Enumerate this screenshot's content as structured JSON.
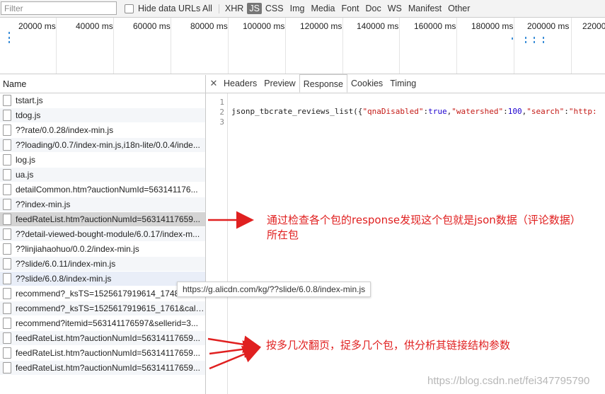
{
  "toolbar": {
    "filter_placeholder": "Filter",
    "hide_data_urls_label": "Hide data URLs",
    "type_filters": [
      "All",
      "XHR",
      "JS",
      "CSS",
      "Img",
      "Media",
      "Font",
      "Doc",
      "WS",
      "Manifest",
      "Other"
    ],
    "active_type": "JS"
  },
  "timeline": {
    "ticks": [
      "20000 ms",
      "40000 ms",
      "60000 ms",
      "80000 ms",
      "100000 ms",
      "120000 ms",
      "140000 ms",
      "160000 ms",
      "180000 ms",
      "200000 ms",
      "22000"
    ]
  },
  "request_list": {
    "header": "Name",
    "selected_index": 8,
    "hovered_index": 12,
    "rows": [
      "tstart.js",
      "tdog.js",
      "??rate/0.0.28/index-min.js",
      "??loading/0.0.7/index-min.js,i18n-lite/0.0.4/inde...",
      "log.js",
      "ua.js",
      "detailCommon.htm?auctionNumId=563141176...",
      "??index-min.js",
      "feedRateList.htm?auctionNumId=56314117659...",
      "??detail-viewed-bought-module/6.0.17/index-m...",
      "??linjiahaohuo/0.0.2/index-min.js",
      "??slide/6.0.11/index-min.js",
      "??slide/6.0.8/index-min.js",
      "recommend?_ksTS=1525617919614_1748&callb...",
      "recommend?_ksTS=1525617919615_1761&callb...",
      "recommend?itemid=563141176597&sellerid=3...",
      "feedRateList.htm?auctionNumId=56314117659...",
      "feedRateList.htm?auctionNumId=56314117659...",
      "feedRateList.htm?auctionNumId=56314117659..."
    ]
  },
  "detail": {
    "close_symbol": "✕",
    "tabs": [
      "Headers",
      "Preview",
      "Response",
      "Cookies",
      "Timing"
    ],
    "active_tab": "Response",
    "line_numbers": [
      "1",
      "2",
      "3"
    ],
    "code": {
      "fn": "jsonp_tbcrate_reviews_list({",
      "k1": "\"qnaDisabled\"",
      "v1": "true",
      "k2": "\"watershed\"",
      "v2": "100",
      "k3": "\"search\"",
      "v3": "\"http:"
    }
  },
  "tooltip": "https://g.alicdn.com/kg/??slide/6.0.8/index-min.js",
  "annotations": {
    "note1_line1": "通过检查各个包的response发现这个包就是json数据（评论数据）",
    "note1_line2": "所在包",
    "note2": "按多几次翻页，捉多几个包，供分析其链接结构参数",
    "color": "#e02020"
  },
  "watermark": "https://blog.csdn.net/fei347795790"
}
